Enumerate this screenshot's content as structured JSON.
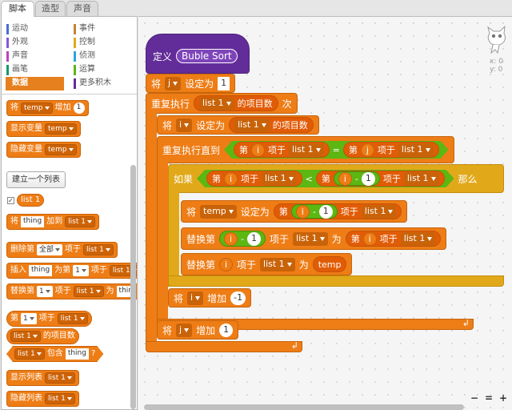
{
  "tabs": [
    "脚本",
    "造型",
    "声音"
  ],
  "categories": {
    "left": [
      {
        "label": "运动",
        "color": "#4a6cd4"
      },
      {
        "label": "外观",
        "color": "#8a55d7"
      },
      {
        "label": "声音",
        "color": "#bb42c3"
      },
      {
        "label": "画笔",
        "color": "#0e9a6c"
      },
      {
        "label": "数据",
        "color": "#ee7d16",
        "selected": true
      }
    ],
    "right": [
      {
        "label": "事件",
        "color": "#c88330"
      },
      {
        "label": "控制",
        "color": "#e1a91a"
      },
      {
        "label": "侦测",
        "color": "#2ca5e2"
      },
      {
        "label": "运算",
        "color": "#5cb712"
      },
      {
        "label": "更多积木",
        "color": "#632d99"
      }
    ]
  },
  "palette": {
    "change_by": {
      "prefix": "将",
      "var": "temp",
      "mid": "增加",
      "num": "1"
    },
    "show_var": {
      "label": "显示变量",
      "var": "temp"
    },
    "hide_var": {
      "label": "隐藏变量",
      "var": "temp"
    },
    "make_list": "建立一个列表",
    "list_reporter": "list 1",
    "add_to": {
      "prefix": "将",
      "item": "thing",
      "mid": "加到",
      "list": "list 1"
    },
    "delete_of": {
      "prefix": "删除第",
      "idx": "全部",
      "mid": "项于",
      "list": "list 1"
    },
    "insert_at": {
      "prefix": "插入",
      "item": "thing",
      "mid": "为第",
      "idx": "1",
      "mid2": "项于",
      "list": "list 1"
    },
    "replace_item": {
      "prefix": "替换第",
      "idx": "1",
      "mid": "项于",
      "list": "list 1",
      "mid2": "为",
      "item": "thin"
    },
    "item_of": {
      "prefix": "第",
      "idx": "1",
      "mid": "项于",
      "list": "list 1"
    },
    "length_of": {
      "list": "list 1",
      "suffix": "的项目数"
    },
    "contains": {
      "list": "list 1",
      "mid": "包含",
      "item": "thing",
      "q": "?"
    },
    "show_list": {
      "label": "显示列表",
      "list": "list 1"
    },
    "hide_list": {
      "label": "隐藏列表",
      "list": "list 1"
    }
  },
  "script": {
    "define": {
      "label": "定义",
      "name": "Buble Sort"
    },
    "set_j": {
      "prefix": "将",
      "var": "j",
      "mid": "设定为",
      "value": "1"
    },
    "repeat": {
      "prefix": "重复执行",
      "list": "list 1",
      "mid": "的项目数",
      "suffix": "次"
    },
    "set_i": {
      "prefix": "将",
      "var": "i",
      "mid": "设定为",
      "list": "list 1",
      "suffix": "的项目数"
    },
    "repeat_until": {
      "prefix": "重复执行直到",
      "item1": "第",
      "var1": "i",
      "mid1": "项于",
      "list1": "list 1",
      "op": "=",
      "item2": "第",
      "var2": "j",
      "mid2": "项于",
      "list2": "list 1"
    },
    "if": {
      "prefix": "如果",
      "item1": "第",
      "var1": "i",
      "mid1": "项于",
      "list1": "list 1",
      "op": "<",
      "item2": "第",
      "var2": "i",
      "minus": "-",
      "one": "1",
      "mid2": "项于",
      "list2": "list 1",
      "suffix": "那么"
    },
    "set_temp": {
      "prefix": "将",
      "var": "temp",
      "mid": "设定为",
      "item": "第",
      "i": "i",
      "minus": "-",
      "one": "1",
      "mid2": "项于",
      "list": "list 1"
    },
    "replace1": {
      "prefix": "替换第",
      "i": "i",
      "minus": "-",
      "one": "1",
      "mid": "项于",
      "list": "list 1",
      "mid2": "为",
      "item": "第",
      "i2": "i",
      "mid3": "项于",
      "list2": "list 1"
    },
    "replace2": {
      "prefix": "替换第",
      "i": "i",
      "mid": "项于",
      "list": "list 1",
      "mid2": "为",
      "val": "temp"
    },
    "change_i": {
      "prefix": "将",
      "var": "i",
      "mid": "增加",
      "value": "-1"
    },
    "change_j": {
      "prefix": "将",
      "var": "j",
      "mid": "增加",
      "value": "1"
    }
  },
  "stage_info": {
    "x": "x: 0",
    "y": "y: 0"
  },
  "zoom": [
    "−",
    "=",
    "+"
  ]
}
